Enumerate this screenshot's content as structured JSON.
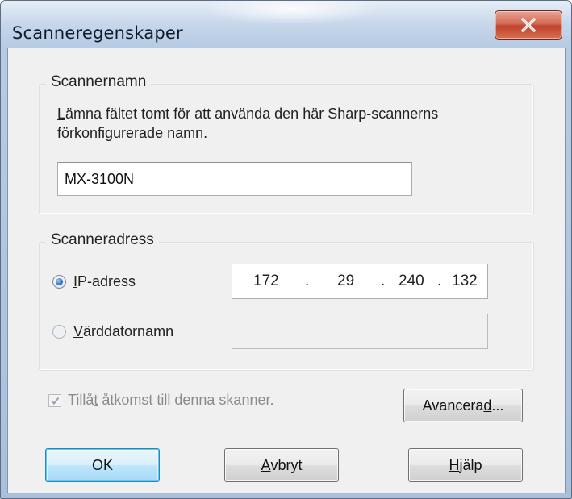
{
  "window": {
    "title": "Scanneregenskaper",
    "close_icon": "close-x-icon"
  },
  "scanner_name_group": {
    "label": "Scannernamn",
    "description_accel": "L",
    "description_rest_line1": "ämna fältet tomt för att använda den här Sharp-scannerns",
    "description_line2": "förkonfigurerade namn.",
    "name_value": "MX-3100N"
  },
  "scanner_address_group": {
    "label": "Scanneradress",
    "ip_option": {
      "accel": "I",
      "rest": "P-adress",
      "selected": true
    },
    "ip_octets": [
      "172",
      "29",
      "240",
      "132"
    ],
    "ip_separator": ".",
    "host_option": {
      "accel": "V",
      "rest": "ärddatornamn",
      "selected": false
    },
    "host_value": ""
  },
  "access_checkbox": {
    "label_pre": "Tillå",
    "label_accel": "t",
    "label_post": " åtkomst till denna skanner.",
    "checked": true,
    "enabled": false
  },
  "buttons": {
    "advanced": {
      "pre": "Avancera",
      "accel": "d",
      "post": "..."
    },
    "ok": "OK",
    "cancel": {
      "accel": "A",
      "rest": "vbryt"
    },
    "help": {
      "accel": "H",
      "rest": "jälp"
    }
  },
  "colors": {
    "dialog_bg": "#f0f0f0",
    "close_button": "#c0432d",
    "default_button_border": "#3c7fb1",
    "radio_selected": "#2b6fc4"
  }
}
